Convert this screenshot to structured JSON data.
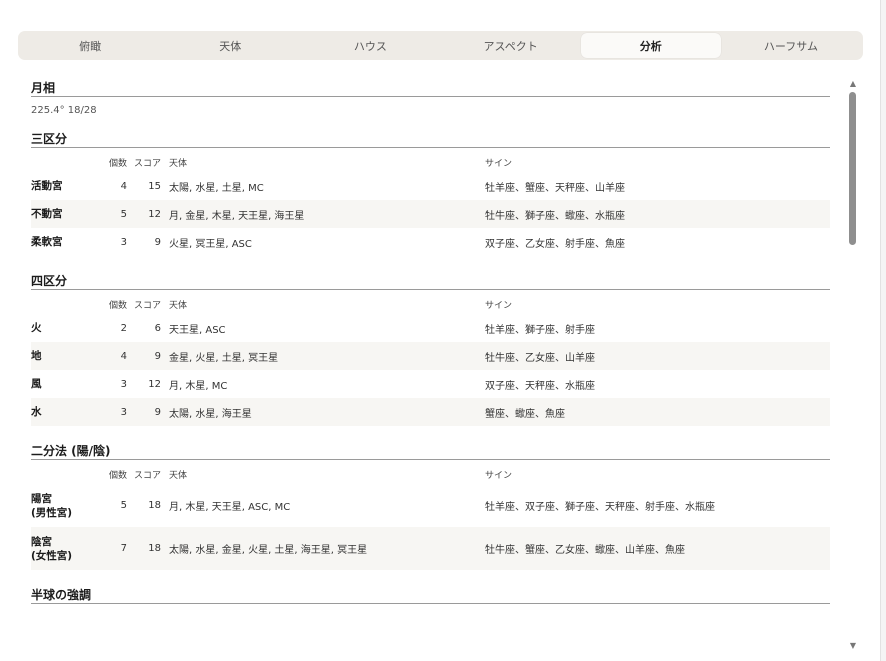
{
  "tabs": [
    {
      "label": "俯瞰"
    },
    {
      "label": "天体"
    },
    {
      "label": "ハウス"
    },
    {
      "label": "アスペクト"
    },
    {
      "label": "分析"
    },
    {
      "label": "ハーフサム"
    }
  ],
  "active_tab": "分析",
  "moon_phase": {
    "title": "月相",
    "value": "225.4° 18/28"
  },
  "columns": {
    "count": "個数",
    "score": "スコア",
    "planets": "天体",
    "signs": "サイン"
  },
  "modality": {
    "title": "三区分",
    "rows": [
      {
        "name": "活動宮",
        "count": "4",
        "score": "15",
        "planets": "太陽, 水星, 土星, MC",
        "signs": "牡羊座、蟹座、天秤座、山羊座"
      },
      {
        "name": "不動宮",
        "count": "5",
        "score": "12",
        "planets": "月, 金星, 木星, 天王星, 海王星",
        "signs": "牡牛座、獅子座、蠍座、水瓶座"
      },
      {
        "name": "柔軟宮",
        "count": "3",
        "score": "9",
        "planets": "火星, 冥王星, ASC",
        "signs": "双子座、乙女座、射手座、魚座"
      }
    ]
  },
  "elements": {
    "title": "四区分",
    "rows": [
      {
        "name": "火",
        "count": "2",
        "score": "6",
        "planets": "天王星, ASC",
        "signs": "牡羊座、獅子座、射手座"
      },
      {
        "name": "地",
        "count": "4",
        "score": "9",
        "planets": "金星, 火星, 土星, 冥王星",
        "signs": "牡牛座、乙女座、山羊座"
      },
      {
        "name": "風",
        "count": "3",
        "score": "12",
        "planets": "月, 木星, MC",
        "signs": "双子座、天秤座、水瓶座"
      },
      {
        "name": "水",
        "count": "3",
        "score": "9",
        "planets": "太陽, 水星, 海王星",
        "signs": "蟹座、蠍座、魚座"
      }
    ]
  },
  "polarity": {
    "title": "二分法 (陽/陰)",
    "rows": [
      {
        "name_line1": "陽宮",
        "name_line2": "(男性宮)",
        "count": "5",
        "score": "18",
        "planets": "月, 木星, 天王星, ASC, MC",
        "signs": "牡羊座、双子座、獅子座、天秤座、射手座、水瓶座"
      },
      {
        "name_line1": "陰宮",
        "name_line2": "(女性宮)",
        "count": "7",
        "score": "18",
        "planets": "太陽, 水星, 金星, 火星, 土星, 海王星, 冥王星",
        "signs": "牡牛座、蟹座、乙女座、蠍座、山羊座、魚座"
      }
    ]
  },
  "hemisphere": {
    "title": "半球の強調"
  },
  "icons": {
    "scroll_up": "triangle-up-icon",
    "scroll_down": "triangle-down-icon"
  }
}
